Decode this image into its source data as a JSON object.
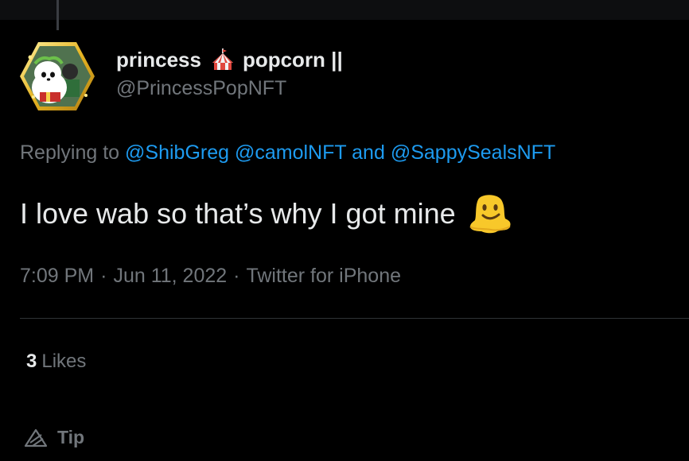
{
  "tweet": {
    "author": {
      "name_part1": "princess",
      "name_icon": "circus-tent-icon",
      "name_part2": "popcorn ||",
      "handle": "@PrincessPopNFT",
      "avatar": "hexagon-nft-avatar"
    },
    "replying_prefix": "Replying to",
    "mentions": [
      "@ShibGreg",
      "@camolNFT",
      "@SappySealsNFT"
    ],
    "mention_joiner": "and",
    "text": "I love wab so that’s why I got mine",
    "text_emoji": "melting-face-icon",
    "time": "7:09 PM",
    "separator": "·",
    "date": "Jun 11, 2022",
    "source": "Twitter for iPhone",
    "likes_count": "3",
    "likes_label": "Likes",
    "tip_label": "Tip",
    "tip_icon": "tip-icon"
  },
  "colors": {
    "background": "#000000",
    "primary_text": "#e7e9ea",
    "secondary_text": "#71767b",
    "link": "#1d9bf0",
    "divider": "#2f3336"
  }
}
